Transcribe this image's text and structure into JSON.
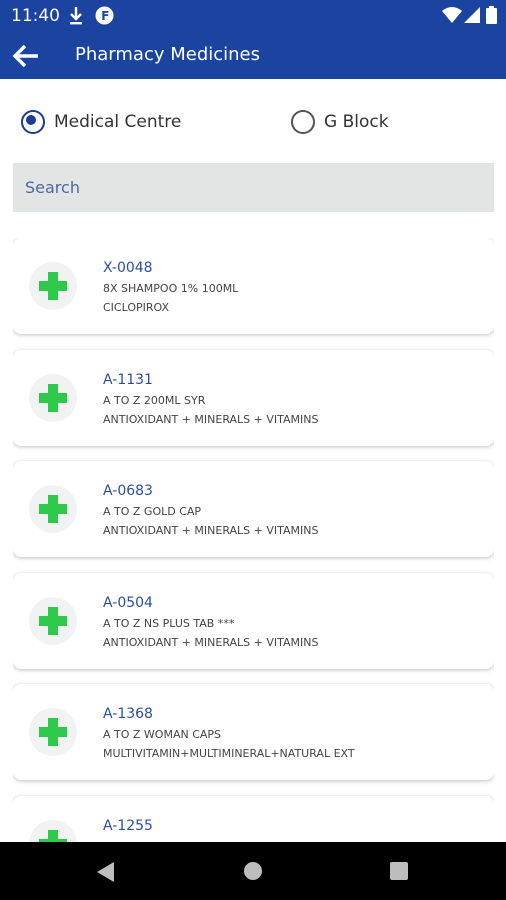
{
  "status_bar": {
    "time": "11:40"
  },
  "toolbar": {
    "title": "Pharmacy Medicines"
  },
  "locations": [
    {
      "label": "Medical Centre",
      "selected": true
    },
    {
      "label": "G Block",
      "selected": false
    }
  ],
  "search": {
    "placeholder": "Search"
  },
  "medicines": [
    {
      "code": "X-0048",
      "name": "8X SHAMPOO  1% 100ML",
      "composition": "CICLOPIROX"
    },
    {
      "code": "A-1131",
      "name": "A TO Z 200ML SYR",
      "composition": "ANTIOXIDANT + MINERALS + VITAMINS"
    },
    {
      "code": "A-0683",
      "name": "A TO Z GOLD CAP",
      "composition": "ANTIOXIDANT + MINERALS + VITAMINS"
    },
    {
      "code": "A-0504",
      "name": "A TO Z NS PLUS TAB ***",
      "composition": "ANTIOXIDANT + MINERALS + VITAMINS"
    },
    {
      "code": "A-1368",
      "name": "A TO Z WOMAN CAPS",
      "composition": "MULTIVITAMIN+MULTIMINERAL+NATURAL EXT"
    },
    {
      "code": "A-1255",
      "name": "",
      "composition": ""
    }
  ],
  "colors": {
    "primary": "#1a44a0",
    "accent_green": "#2ec84a",
    "search_bg": "#e3e5e5"
  },
  "icons": [
    "download-icon",
    "app-notification-icon",
    "wifi-icon",
    "signal-icon",
    "battery-icon",
    "back-arrow-icon",
    "medical-cross-icon",
    "nav-back-icon",
    "nav-home-icon",
    "nav-recents-icon"
  ]
}
